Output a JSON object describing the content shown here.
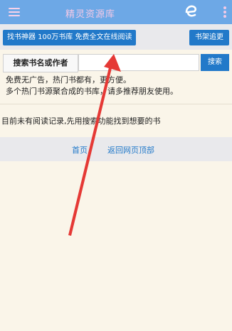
{
  "header": {
    "title": "精灵资源库",
    "menu_icon": "menu-icon",
    "logo_icon": "e-logo-icon",
    "more_icon": "more-vert-icon",
    "bar_color": "#6da8e6",
    "title_color": "#f3c9e6"
  },
  "toolbar": {
    "promo_label": "找书神器 100万书库 免费全文在线阅读",
    "shelf_label": "书架追更",
    "button_color": "#2279c9"
  },
  "search": {
    "label": "搜索书名或作者",
    "value": "",
    "placeholder": "",
    "button_label": "搜索"
  },
  "intro": {
    "line1": "免费无广告，热门书都有，更方便。",
    "line2": "多个热门书源聚合成的书库，请多推荐朋友使用。"
  },
  "history": {
    "empty_message": "目前未有阅读记录,先用搜索功能找到想要的书"
  },
  "footer": {
    "home_label": "首页",
    "top_label": "返回网页顶部",
    "link_color": "#2279c9"
  },
  "annotation": {
    "color": "#e53935"
  }
}
